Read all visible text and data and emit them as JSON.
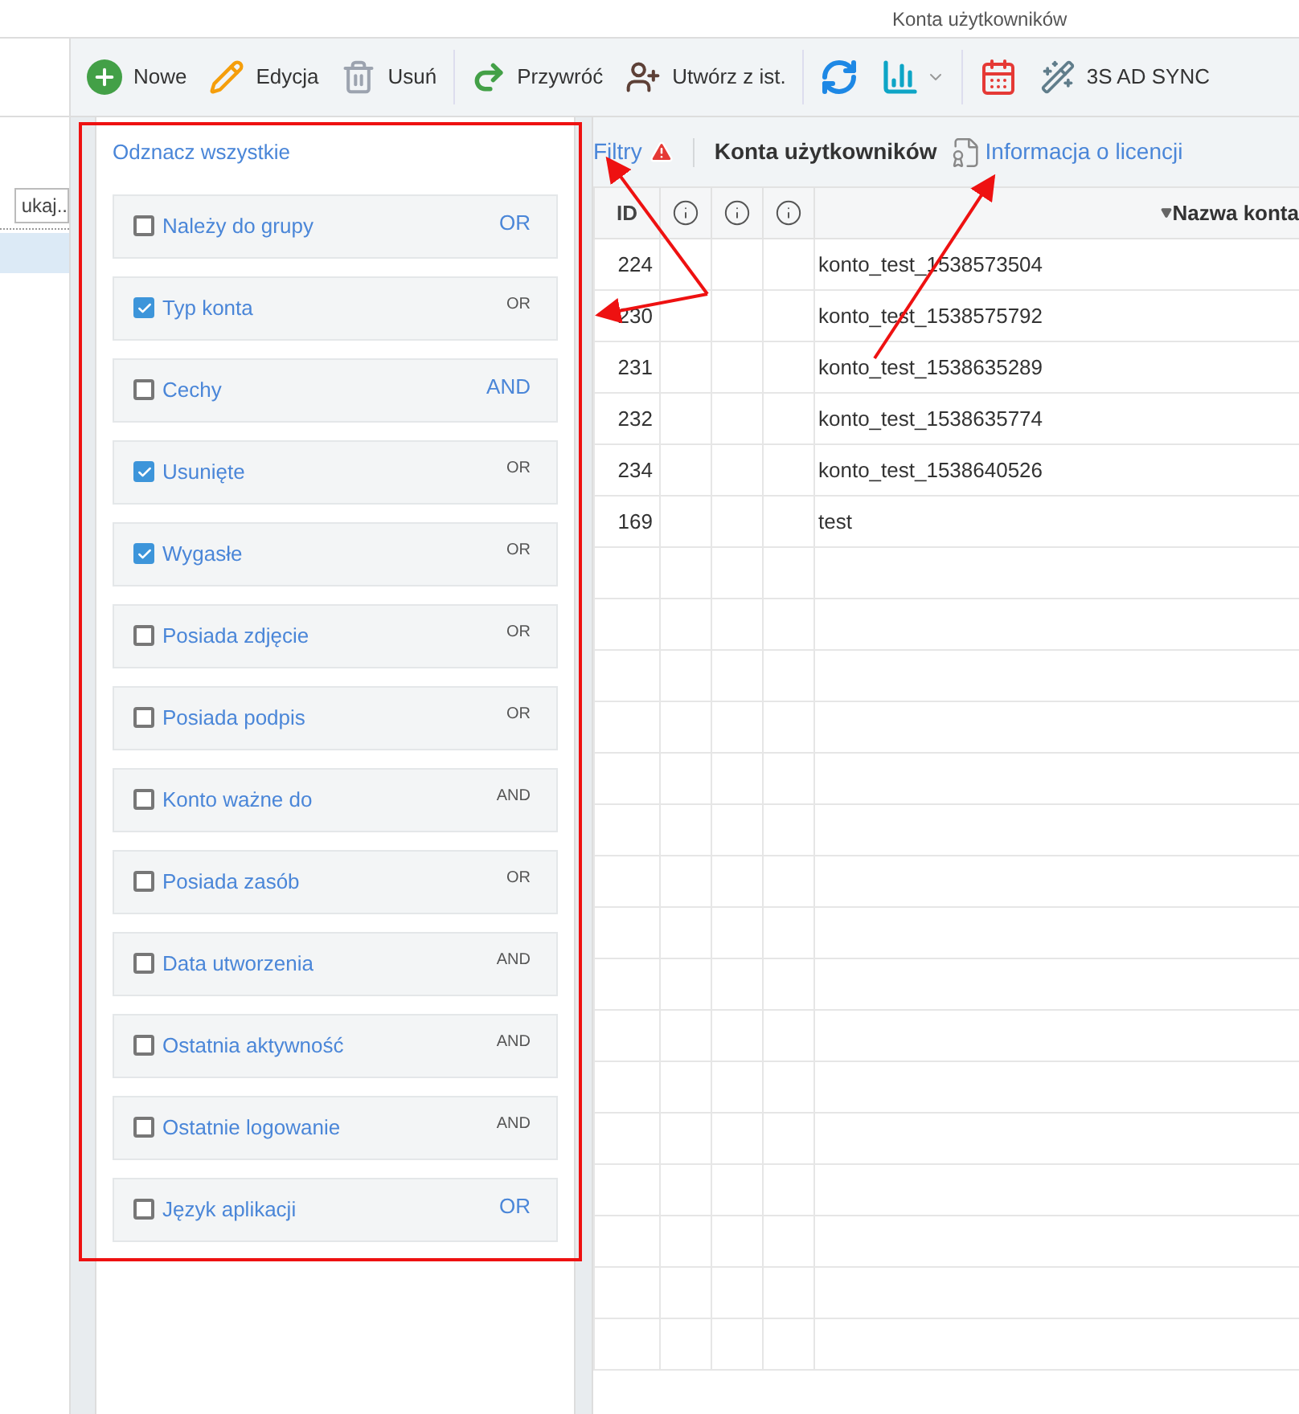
{
  "window": {
    "title": "Konta użytkowników"
  },
  "toolbar": {
    "groups": [
      [
        {
          "kind": "plus",
          "label": "Nowe"
        },
        {
          "kind": "pencil",
          "label": "Edycja"
        },
        {
          "kind": "trash",
          "label": "Usuń"
        }
      ],
      [
        {
          "kind": "redo",
          "label": "Przywróć"
        },
        {
          "kind": "user-plus",
          "label": "Utwórz z ist."
        }
      ],
      [
        {
          "kind": "sync"
        },
        {
          "kind": "chart"
        }
      ],
      [
        {
          "kind": "calendar"
        },
        {
          "kind": "wand",
          "label": "3S AD SYNC"
        }
      ]
    ]
  },
  "sidebar": {
    "search_value": "ukaj.."
  },
  "filters": {
    "select_all": "Odznacz wszystkie",
    "items": [
      {
        "label": "Należy do grupy",
        "checked": false,
        "operator": "OR",
        "emphasized": true
      },
      {
        "label": "Typ konta",
        "checked": true,
        "operator": "OR",
        "emphasized": false
      },
      {
        "label": "Cechy",
        "checked": false,
        "operator": "AND",
        "emphasized": true
      },
      {
        "label": "Usunięte",
        "checked": true,
        "operator": "OR",
        "emphasized": false
      },
      {
        "label": "Wygasłe",
        "checked": true,
        "operator": "OR",
        "emphasized": false
      },
      {
        "label": "Posiada zdjęcie",
        "checked": false,
        "operator": "OR",
        "emphasized": false
      },
      {
        "label": "Posiada podpis",
        "checked": false,
        "operator": "OR",
        "emphasized": false
      },
      {
        "label": "Konto ważne do",
        "checked": false,
        "operator": "AND",
        "emphasized": false
      },
      {
        "label": "Posiada zasób",
        "checked": false,
        "operator": "OR",
        "emphasized": false
      },
      {
        "label": "Data utworzenia",
        "checked": false,
        "operator": "AND",
        "emphasized": false
      },
      {
        "label": "Ostatnia aktywność",
        "checked": false,
        "operator": "AND",
        "emphasized": false
      },
      {
        "label": "Ostatnie logowanie",
        "checked": false,
        "operator": "AND",
        "emphasized": false
      },
      {
        "label": "Język aplikacji",
        "checked": false,
        "operator": "OR",
        "emphasized": true
      }
    ]
  },
  "header": {
    "filter_link": "Filtry",
    "title": "Konta użytkowników",
    "license_link": "Informacja o licencji"
  },
  "table": {
    "columns": [
      {
        "kind": "text",
        "label": "ID"
      },
      {
        "kind": "info"
      },
      {
        "kind": "info"
      },
      {
        "kind": "info"
      },
      {
        "kind": "sorted",
        "label": "Nazwa konta"
      }
    ],
    "rows": [
      {
        "id": "224",
        "name": "konto_test_1538573504"
      },
      {
        "id": "230",
        "name": "konto_test_1538575792"
      },
      {
        "id": "231",
        "name": "konto_test_1538635289"
      },
      {
        "id": "232",
        "name": "konto_test_1538635774"
      },
      {
        "id": "234",
        "name": "konto_test_1538640526"
      },
      {
        "id": "169",
        "name": "test"
      }
    ]
  }
}
